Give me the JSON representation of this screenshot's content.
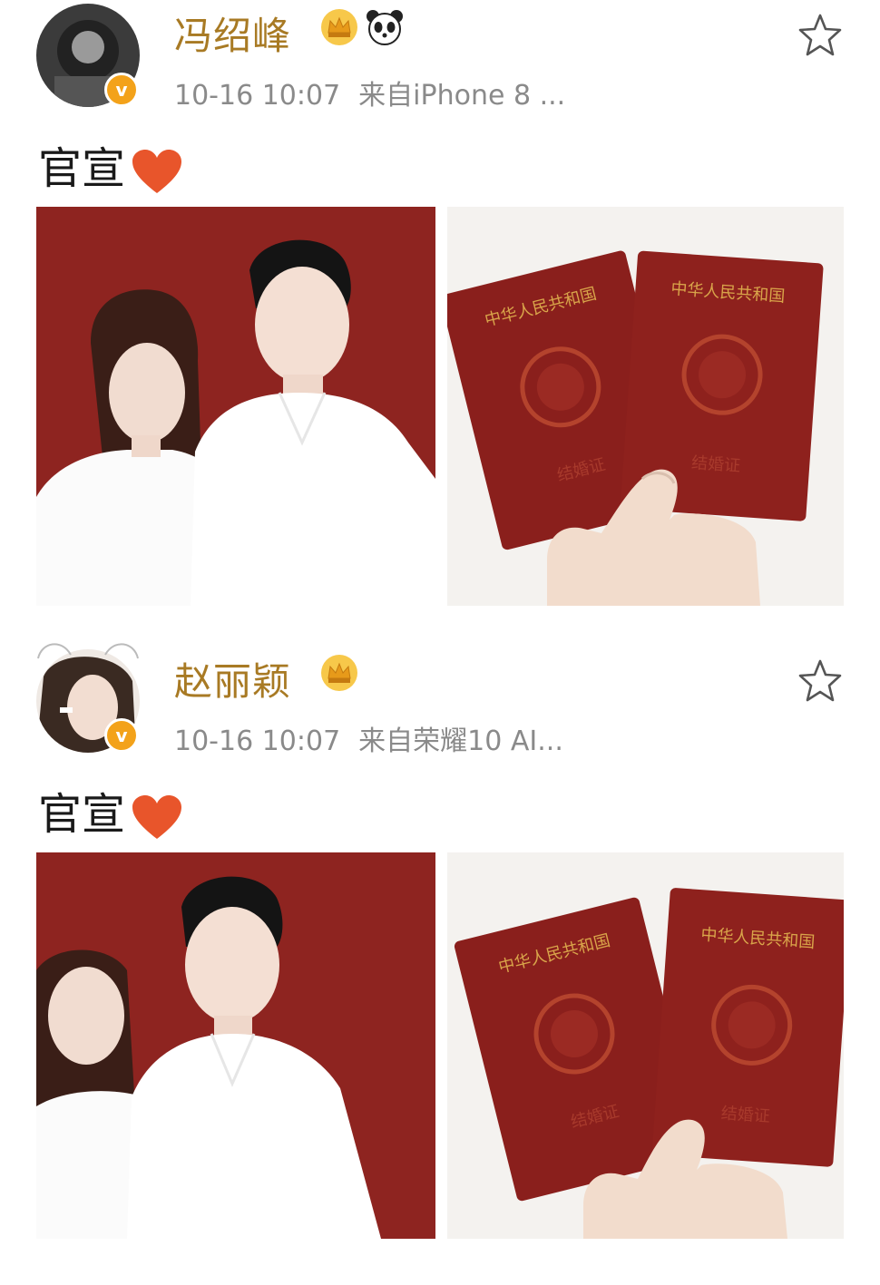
{
  "posts": [
    {
      "username": "冯绍峰",
      "timestamp": "10-16 10:07",
      "source": "来自iPhone 8 ...",
      "caption": "官宣",
      "badge_letter": "v",
      "icons": [
        "vip-crown-icon",
        "panda-icon",
        "star-icon",
        "heart-icon"
      ],
      "booklet_title": "中华人民共和国",
      "booklet_label": "结婚证"
    },
    {
      "username": "赵丽颖",
      "timestamp": "10-16 10:07",
      "source": "来自荣耀10 AI...",
      "caption": "官宣",
      "badge_letter": "v",
      "icons": [
        "vip-crown-icon",
        "star-icon",
        "heart-icon"
      ],
      "booklet_title": "中华人民共和国",
      "booklet_label": "结婚证"
    }
  ],
  "colors": {
    "username": "#a87a24",
    "meta": "#8a8a8a",
    "badge": "#f3a21a",
    "heart": "#e8552b",
    "photo_background": "#8e2420",
    "booklet": "#8a1f1c"
  }
}
